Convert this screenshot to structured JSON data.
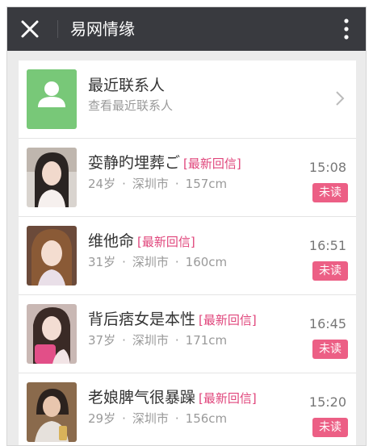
{
  "header": {
    "title": "易网情缘"
  },
  "recent": {
    "title": "最近联系人",
    "subtitle": "查看最近联系人"
  },
  "contacts": [
    {
      "name": "娈静旳埋葬ご",
      "tag": "[最新回信]",
      "age": "24岁",
      "city": "深圳市",
      "height": "157cm",
      "time": "15:08",
      "status": "未读"
    },
    {
      "name": "维他命",
      "tag": "[最新回信]",
      "age": "31岁",
      "city": "深圳市",
      "height": "160cm",
      "time": "16:51",
      "status": "未读"
    },
    {
      "name": "背后痞女是本性",
      "tag": "[最新回信]",
      "age": "37岁",
      "city": "深圳市",
      "height": "171cm",
      "time": "16:45",
      "status": "未读"
    },
    {
      "name": "老娘脾气很暴躁",
      "tag": "[最新回信]",
      "age": "29岁",
      "city": "深圳市",
      "height": "156cm",
      "time": "15:20",
      "status": "未读"
    }
  ],
  "colors": {
    "titlebar": "#393a3f",
    "accent": "#e0457b",
    "badge": "#ec5f85",
    "recent_avatar": "#78c878"
  },
  "icons": {
    "close": "close-icon",
    "more": "more-vertical-icon",
    "chevron": "chevron-right-icon",
    "person": "person-icon"
  }
}
